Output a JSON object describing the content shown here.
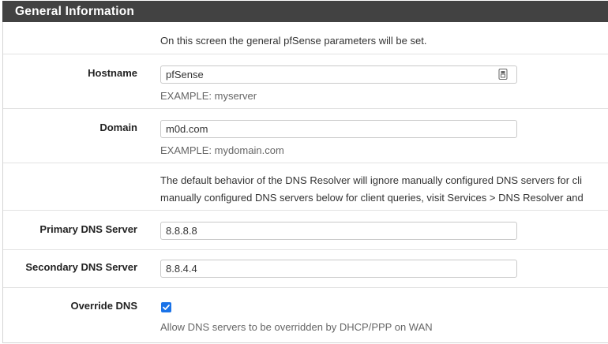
{
  "panel": {
    "title": "General Information"
  },
  "intro": {
    "text": "On this screen the general pfSense parameters will be set."
  },
  "hostname": {
    "label": "Hostname",
    "value": "pfSense",
    "help": "EXAMPLE: myserver",
    "icon": "password-manager-icon"
  },
  "domain": {
    "label": "Domain",
    "value": "m0d.com",
    "help": "EXAMPLE: mydomain.com"
  },
  "dns_note": {
    "line1": "The default behavior of the DNS Resolver will ignore manually configured DNS servers for cli",
    "line2": "manually configured DNS servers below for client queries, visit Services > DNS Resolver and"
  },
  "primary_dns": {
    "label": "Primary DNS Server",
    "value": "8.8.8.8"
  },
  "secondary_dns": {
    "label": "Secondary DNS Server",
    "value": "8.8.4.4"
  },
  "override_dns": {
    "label": "Override DNS",
    "checked": true,
    "help": "Allow DNS servers to be overridden by DHCP/PPP on WAN"
  },
  "colors": {
    "header_bg": "#424242",
    "accent": "#1a73e8"
  }
}
